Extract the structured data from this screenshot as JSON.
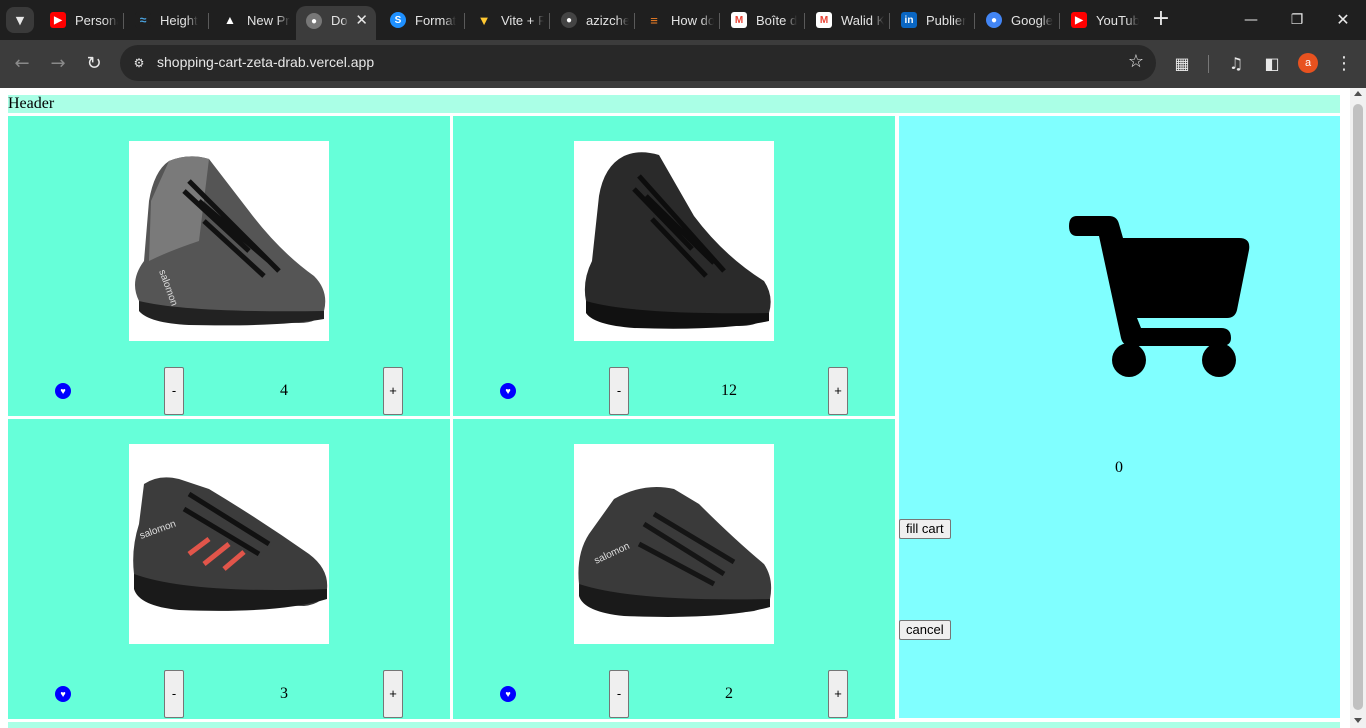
{
  "browser": {
    "tabs": [
      {
        "title": "Persona",
        "icon": "youtube-icon",
        "color": "#ff0000"
      },
      {
        "title": "Height",
        "icon": "height-app-icon",
        "color": "#4aa3df"
      },
      {
        "title": "New Pr",
        "icon": "vercel-triangle-icon",
        "color": "#ffffff"
      },
      {
        "title": "Do",
        "icon": "globe-icon",
        "color": "#8a8a8a",
        "active": true
      },
      {
        "title": "Format",
        "icon": "skype-icon",
        "color": "#1e90ff"
      },
      {
        "title": "Vite + R",
        "icon": "vite-icon",
        "color": "#9b59ff"
      },
      {
        "title": "azizche",
        "icon": "github-icon",
        "color": "#444444"
      },
      {
        "title": "How do",
        "icon": "stackoverflow-icon",
        "color": "#f48024"
      },
      {
        "title": "Boîte d",
        "icon": "gmail-icon",
        "color": "#ea4335"
      },
      {
        "title": "Walid K",
        "icon": "gmail-icon",
        "color": "#ea4335"
      },
      {
        "title": "Publier",
        "icon": "linkedin-icon",
        "color": "#0a66c2"
      },
      {
        "title": "Google",
        "icon": "google-globe-icon",
        "color": "#4285f4"
      },
      {
        "title": "YouTub",
        "icon": "youtube-icon",
        "color": "#ff0000"
      }
    ],
    "url": "shopping-cart-zeta-drab.vercel.app",
    "profile_initial": "a"
  },
  "page": {
    "header": "Header",
    "products": [
      {
        "name": "salomon-quest-boot-grey",
        "quantity": "4"
      },
      {
        "name": "salomon-tactical-boot-black",
        "quantity": "12"
      },
      {
        "name": "salomon-xultra-low-red",
        "quantity": "3"
      },
      {
        "name": "salomon-xultra-mid-black",
        "quantity": "2"
      }
    ],
    "minus_label": "-",
    "plus_label": "+",
    "cart": {
      "count": "0",
      "fill_label": "fill cart",
      "cancel_label": "cancel"
    }
  },
  "colors": {
    "card_bg": "#66ffd9",
    "cart_bg": "#80ffff",
    "header_bg": "#aaffe6",
    "heart": "#0000ff"
  }
}
